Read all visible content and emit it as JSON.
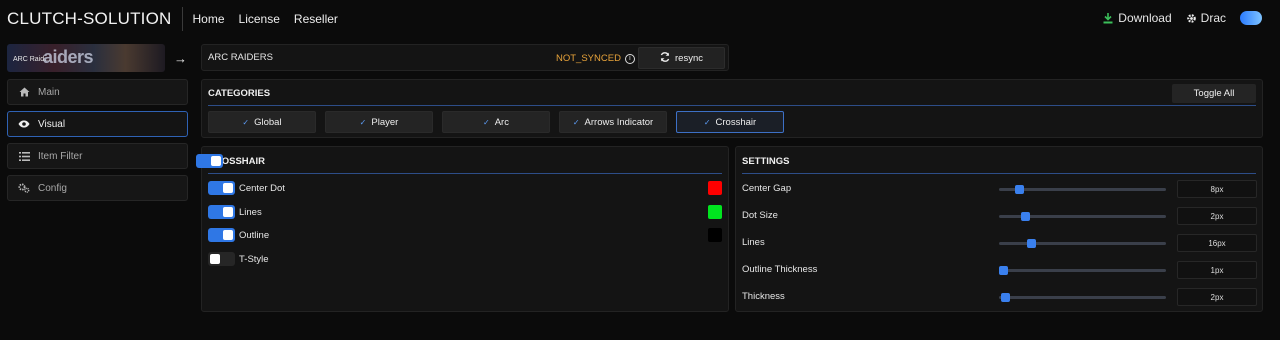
{
  "app": {
    "brand": "CLUTCH-SOLUTION"
  },
  "nav": {
    "items": [
      "Home",
      "License",
      "Reseller"
    ]
  },
  "topright": {
    "download": "Download",
    "user": "Drac"
  },
  "sidebar": {
    "game_banner_text": "ARC Raid...",
    "game_banner_logo": "aiders",
    "items": [
      {
        "label": "Main",
        "icon": "home-icon"
      },
      {
        "label": "Visual",
        "icon": "eye-icon",
        "active": true
      },
      {
        "label": "Item Filter",
        "icon": "list-icon"
      },
      {
        "label": "Config",
        "icon": "gears-icon"
      }
    ]
  },
  "game_panel": {
    "title": "ARC RAIDERS",
    "status": "NOT_SYNCED",
    "resync_label": "resync"
  },
  "categories": {
    "title": "CATEGORIES",
    "toggle_all": "Toggle All",
    "items": [
      "Global",
      "Player",
      "Arc",
      "Arrows Indicator",
      "Crosshair"
    ],
    "selected": "Crosshair"
  },
  "crosshair": {
    "title": "CROSSHAIR",
    "enabled": true,
    "options": [
      {
        "label": "Center Dot",
        "on": true,
        "color": "#ff0000"
      },
      {
        "label": "Lines",
        "on": true,
        "color": "#00e51f"
      },
      {
        "label": "Outline",
        "on": true,
        "color": "#000000"
      },
      {
        "label": "T-Style",
        "on": false
      }
    ]
  },
  "settings": {
    "title": "SETTINGS",
    "rows": [
      {
        "label": "Center Gap",
        "value": "8px",
        "level": 0.1
      },
      {
        "label": "Dot Size",
        "value": "2px",
        "level": 0.14
      },
      {
        "label": "Lines",
        "value": "16px",
        "level": 0.18
      },
      {
        "label": "Outline Thickness",
        "value": "1px",
        "level": 0.0
      },
      {
        "label": "Thickness",
        "value": "2px",
        "level": 0.01
      }
    ]
  },
  "colors": {
    "accent": "#2f77e5",
    "status": "#e8a33a",
    "separator": "#2d4d88"
  }
}
